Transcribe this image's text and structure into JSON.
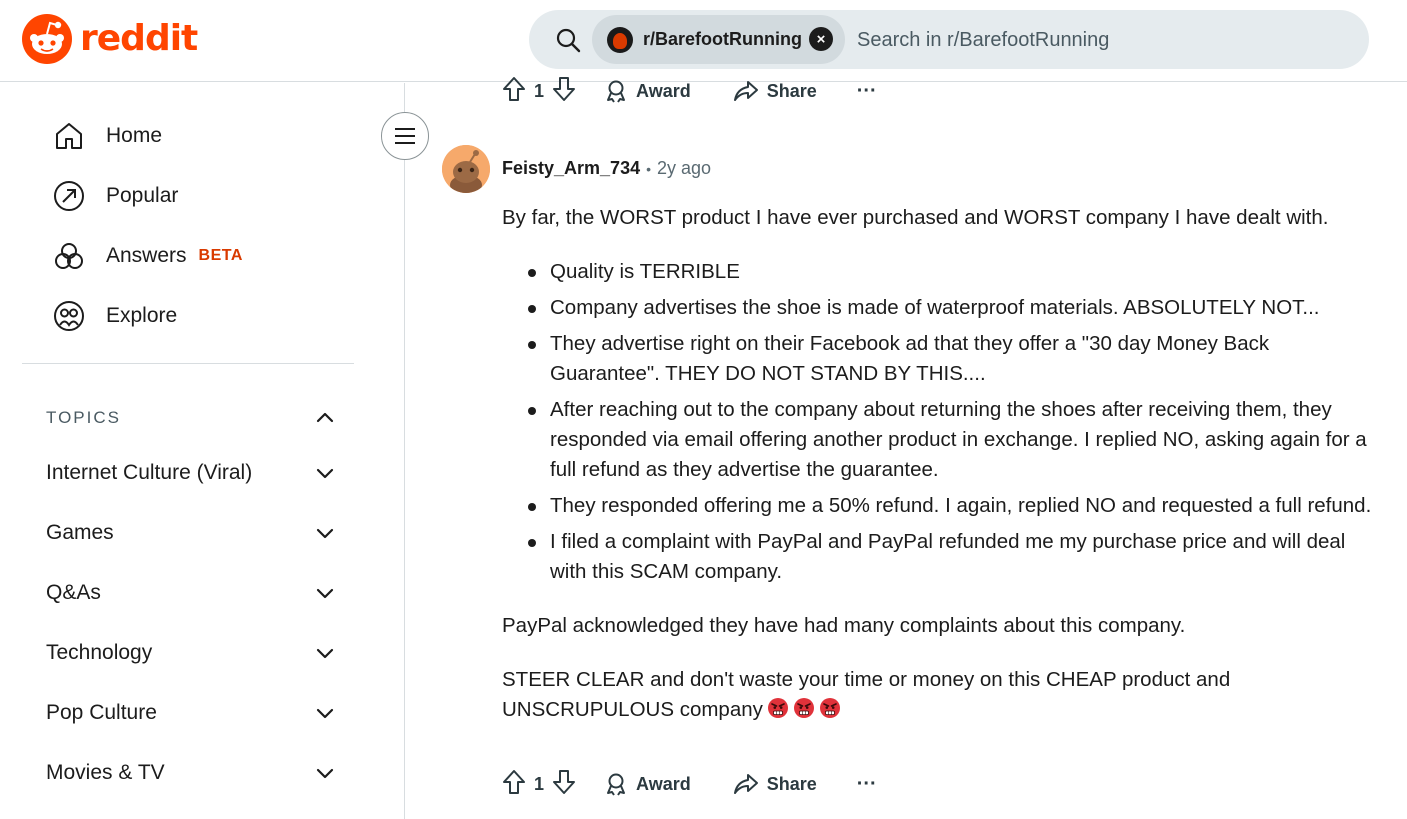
{
  "brand": {
    "name": "reddit",
    "color": "#ff4500"
  },
  "search": {
    "chip_label": "r/BarefootRunning",
    "chip_close": "×",
    "placeholder": "Search in r/BarefootRunning"
  },
  "sidebar": {
    "items": [
      {
        "label": "Home",
        "icon": "home-icon"
      },
      {
        "label": "Popular",
        "icon": "popular-icon"
      },
      {
        "label": "Answers",
        "icon": "answers-icon",
        "badge": "BETA"
      },
      {
        "label": "Explore",
        "icon": "explore-icon"
      }
    ],
    "topics_label": "TOPICS",
    "topics": [
      {
        "label": "Internet Culture (Viral)"
      },
      {
        "label": "Games"
      },
      {
        "label": "Q&As"
      },
      {
        "label": "Technology"
      },
      {
        "label": "Pop Culture"
      },
      {
        "label": "Movies & TV"
      }
    ]
  },
  "top_actions": {
    "votes": "1",
    "award": "Award",
    "share": "Share",
    "more": "···"
  },
  "comment": {
    "author": "Feisty_Arm_734",
    "separator": "•",
    "age": "2y ago",
    "intro": "By far, the WORST product I have ever purchased and WORST company I have dealt with.",
    "bullets": [
      "Quality is TERRIBLE",
      "Company advertises the shoe is made of waterproof materials.  ABSOLUTELY NOT...",
      "They advertise right on their Facebook ad that they offer a \"30 day Money Back Guarantee\".  THEY DO NOT STAND BY THIS....",
      "After reaching out to the company about returning the shoes after receiving them, they responded via email offering another product in exchange. I replied NO, asking again for a full refund as they advertise the guarantee.",
      "They responded offering me a 50% refund. I again, replied NO and requested a full refund.",
      "I filed a complaint with PayPal and PayPal refunded me my purchase price and will deal with this SCAM company."
    ],
    "paragraph2": "PayPal acknowledged they have had many complaints about this company.",
    "paragraph3": "STEER CLEAR and don't waste your time or money on this CHEAP product and UNSCRUPULOUS company",
    "emoji_count": 3,
    "actions": {
      "votes": "1",
      "award": "Award",
      "share": "Share",
      "more": "···"
    }
  }
}
